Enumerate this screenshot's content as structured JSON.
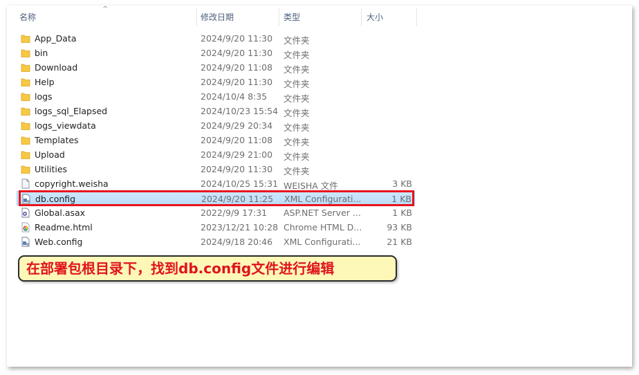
{
  "header": {
    "name_label": "名称",
    "date_label": "修改日期",
    "type_label": "类型",
    "size_label": "大小"
  },
  "files": [
    {
      "name": "App_Data",
      "date": "2024/9/20 11:30",
      "type": "文件夹",
      "size": "",
      "icon": "folder-icon"
    },
    {
      "name": "bin",
      "date": "2024/9/20 11:30",
      "type": "文件夹",
      "size": "",
      "icon": "folder-icon"
    },
    {
      "name": "Download",
      "date": "2024/9/20 11:08",
      "type": "文件夹",
      "size": "",
      "icon": "folder-icon"
    },
    {
      "name": "Help",
      "date": "2024/9/20 11:30",
      "type": "文件夹",
      "size": "",
      "icon": "folder-icon"
    },
    {
      "name": "logs",
      "date": "2024/10/4 8:35",
      "type": "文件夹",
      "size": "",
      "icon": "folder-icon"
    },
    {
      "name": "logs_sql_Elapsed",
      "date": "2024/10/23 15:54",
      "type": "文件夹",
      "size": "",
      "icon": "folder-icon"
    },
    {
      "name": "logs_viewdata",
      "date": "2024/9/29 20:34",
      "type": "文件夹",
      "size": "",
      "icon": "folder-icon"
    },
    {
      "name": "Templates",
      "date": "2024/9/20 11:08",
      "type": "文件夹",
      "size": "",
      "icon": "folder-icon"
    },
    {
      "name": "Upload",
      "date": "2024/9/29 21:00",
      "type": "文件夹",
      "size": "",
      "icon": "folder-icon"
    },
    {
      "name": "Utilities",
      "date": "2024/9/20 11:30",
      "type": "文件夹",
      "size": "",
      "icon": "folder-icon"
    },
    {
      "name": "copyright.weisha",
      "date": "2024/10/25 15:31",
      "type": "WEISHA 文件",
      "size": "3 KB",
      "icon": "generic-file-icon"
    },
    {
      "name": "db.config",
      "date": "2024/9/20 11:25",
      "type": "XML Configurati...",
      "size": "1 KB",
      "icon": "config-file-icon"
    },
    {
      "name": "Global.asax",
      "date": "2022/9/9 17:31",
      "type": "ASP.NET Server ...",
      "size": "1 KB",
      "icon": "asax-file-icon"
    },
    {
      "name": "Readme.html",
      "date": "2023/12/21 10:28",
      "type": "Chrome HTML D...",
      "size": "93 KB",
      "icon": "chrome-html-icon"
    },
    {
      "name": "Web.config",
      "date": "2024/9/18 20:46",
      "type": "XML Configurati...",
      "size": "21 KB",
      "icon": "config-file-icon"
    }
  ],
  "selected_file": "db.config",
  "annotation": {
    "text": "在部署包根目录下，找到db.config文件进行编辑"
  },
  "colors": {
    "folder": "#f7c844",
    "selection": "#cde8ff",
    "highlight": "#e8141c",
    "callout_bg": "#fdf7b8",
    "callout_text": "#e0141c"
  }
}
